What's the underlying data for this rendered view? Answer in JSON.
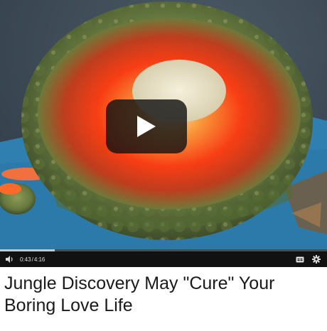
{
  "player": {
    "current_time": "0:43",
    "separator": "/",
    "duration": "4:16",
    "progress_fraction": 0.168,
    "icons": [
      "play-icon",
      "volume-icon",
      "captions-icon",
      "settings-icon"
    ]
  },
  "caption": {
    "line1": "Jungle Discovery May \"Cure\" Your",
    "line2": "Boring Love Life"
  },
  "colors": {
    "caption_text": "#1a1a1a",
    "controls_bg": "#111111"
  }
}
